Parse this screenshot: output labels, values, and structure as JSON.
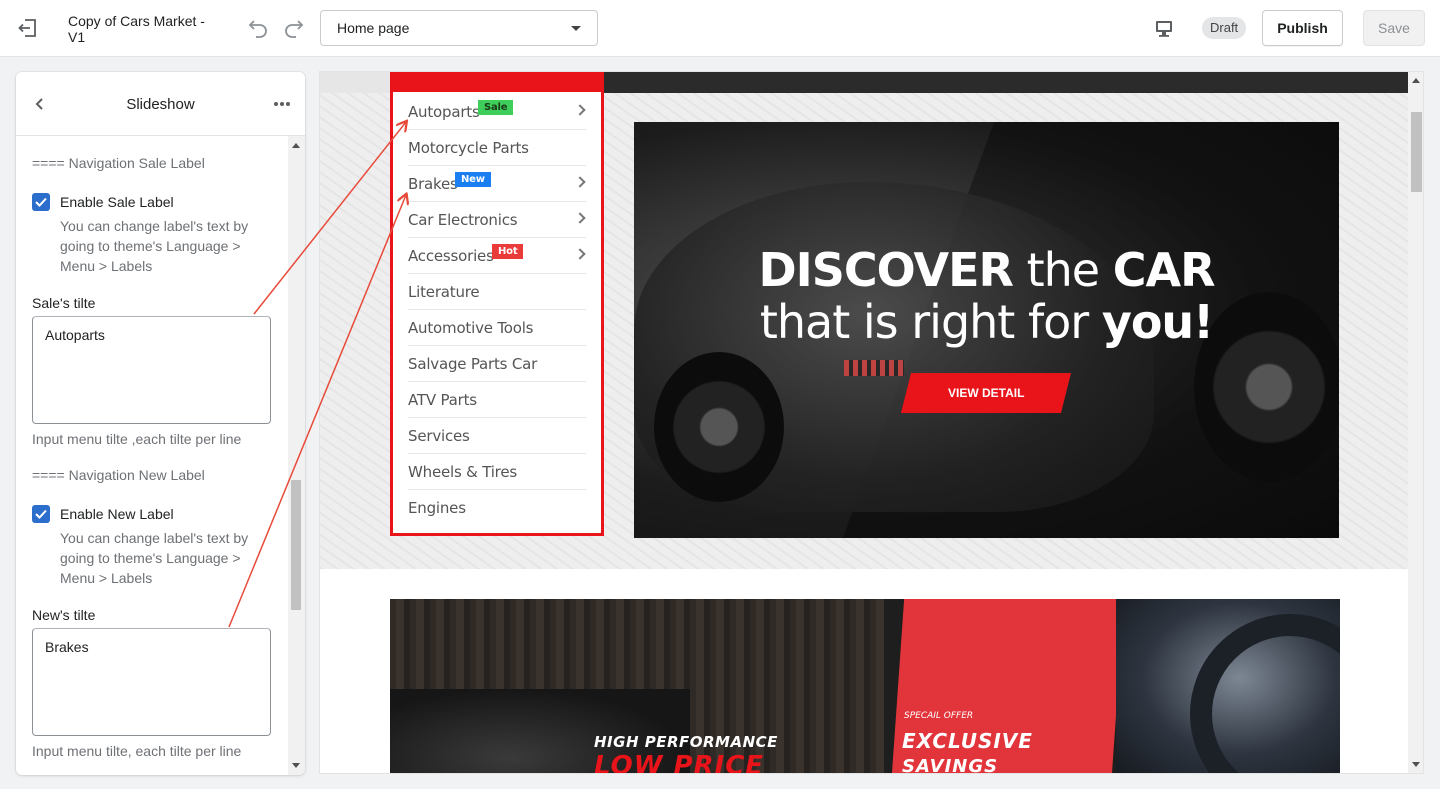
{
  "topbar": {
    "title": "Copy of Cars Market - V1",
    "page_select_value": "Home page",
    "draft_label": "Draft",
    "publish_label": "Publish",
    "save_label": "Save"
  },
  "panel": {
    "title": "Slideshow",
    "sale_section": {
      "heading": "==== Navigation Sale Label",
      "checkbox_label": "Enable Sale Label",
      "checked": true,
      "help": "You can change label's text by going to theme's Language > Menu > Labels",
      "field_label": "Sale's tilte",
      "field_value": "Autoparts",
      "field_help": "Input menu tilte ,each tilte per line"
    },
    "new_section": {
      "heading": "==== Navigation New Label",
      "checkbox_label": "Enable New Label",
      "checked": true,
      "help": "You can change label's text by going to theme's Language > Menu > Labels",
      "field_label": "New's tilte",
      "field_value": "Brakes",
      "field_help": "Input menu tilte, each tilte per line"
    }
  },
  "preview": {
    "menu_items": [
      {
        "label": "Autoparts",
        "chevron": true,
        "tag": "Sale"
      },
      {
        "label": "Motorcycle Parts",
        "chevron": false,
        "tag": ""
      },
      {
        "label": "Brakes",
        "chevron": true,
        "tag": "New"
      },
      {
        "label": "Car Electronics",
        "chevron": true,
        "tag": ""
      },
      {
        "label": "Accessories",
        "chevron": true,
        "tag": "Hot"
      },
      {
        "label": "Literature",
        "chevron": false,
        "tag": ""
      },
      {
        "label": "Automotive Tools",
        "chevron": false,
        "tag": ""
      },
      {
        "label": "Salvage Parts Car",
        "chevron": false,
        "tag": ""
      },
      {
        "label": "ATV Parts",
        "chevron": false,
        "tag": ""
      },
      {
        "label": "Services",
        "chevron": false,
        "tag": ""
      },
      {
        "label": "Wheels & Tires",
        "chevron": false,
        "tag": ""
      },
      {
        "label": "Engines",
        "chevron": false,
        "tag": ""
      }
    ],
    "hero": {
      "line1_bold1": "DISCOVER",
      "line1_normal": " the ",
      "line1_bold2": "CAR",
      "line2_normal": "that is right for ",
      "line2_bold": "you!",
      "button_label": "VIEW DETAIL"
    },
    "banner2": {
      "left_line1": "HIGH PERFORMANCE",
      "left_line2": "LOW PRICE",
      "right_small": "SPECAIL OFFER",
      "right_line1": "EXCLUSIVE",
      "right_line2": "SAVINGS"
    }
  },
  "colors": {
    "accent_red": "#e8141a",
    "checkbox_blue": "#2c6ecb",
    "sale_tag": "#3ecf5a",
    "new_tag": "#1a7ff0",
    "hot_tag": "#ea3b3b"
  },
  "icons": [
    "exit-icon",
    "undo-icon",
    "redo-icon",
    "caret-down-icon",
    "desktop-icon",
    "back-icon",
    "more-icon",
    "checkmark-icon",
    "chevron-right-icon"
  ]
}
